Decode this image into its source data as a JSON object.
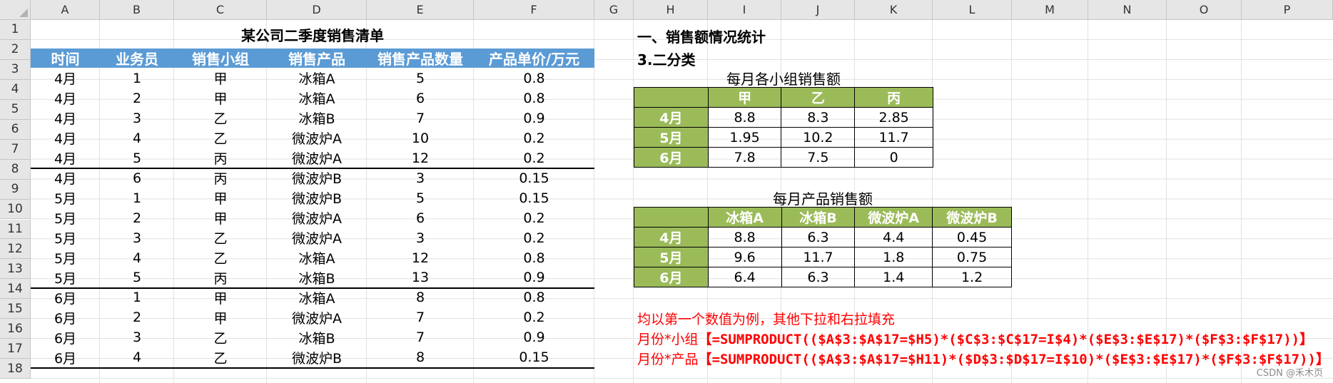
{
  "columns": [
    "A",
    "B",
    "C",
    "D",
    "E",
    "F",
    "G",
    "H",
    "I",
    "J",
    "K",
    "L",
    "M",
    "N",
    "O",
    "P"
  ],
  "rows": [
    "1",
    "2",
    "3",
    "4",
    "5",
    "6",
    "7",
    "8",
    "9",
    "10",
    "11",
    "12",
    "13",
    "14",
    "15",
    "16",
    "17",
    "18"
  ],
  "sheet_title": "某公司二季度销售清单",
  "table_headers": [
    "时间",
    "业务员",
    "销售小组",
    "销售产品",
    "销售产品数量",
    "产品单价/万元"
  ],
  "table_rows": [
    [
      "4月",
      "1",
      "甲",
      "冰箱A",
      "5",
      "0.8"
    ],
    [
      "4月",
      "2",
      "甲",
      "冰箱A",
      "6",
      "0.8"
    ],
    [
      "4月",
      "3",
      "乙",
      "冰箱B",
      "7",
      "0.9"
    ],
    [
      "4月",
      "4",
      "乙",
      "微波炉A",
      "10",
      "0.2"
    ],
    [
      "4月",
      "5",
      "丙",
      "微波炉A",
      "12",
      "0.2"
    ],
    [
      "4月",
      "6",
      "丙",
      "微波炉B",
      "3",
      "0.15"
    ],
    [
      "5月",
      "1",
      "甲",
      "微波炉B",
      "5",
      "0.15"
    ],
    [
      "5月",
      "2",
      "甲",
      "微波炉A",
      "6",
      "0.2"
    ],
    [
      "5月",
      "3",
      "乙",
      "微波炉A",
      "3",
      "0.2"
    ],
    [
      "5月",
      "4",
      "乙",
      "冰箱A",
      "12",
      "0.8"
    ],
    [
      "5月",
      "5",
      "丙",
      "冰箱B",
      "13",
      "0.9"
    ],
    [
      "6月",
      "1",
      "甲",
      "冰箱A",
      "8",
      "0.8"
    ],
    [
      "6月",
      "2",
      "甲",
      "微波炉A",
      "7",
      "0.2"
    ],
    [
      "6月",
      "3",
      "乙",
      "冰箱B",
      "7",
      "0.9"
    ],
    [
      "6月",
      "4",
      "乙",
      "微波炉B",
      "8",
      "0.15"
    ]
  ],
  "section_title": "一、销售额情况统计",
  "subsection": "3.二分类",
  "pivot1": {
    "title": "每月各小组销售额",
    "col_headers": [
      "甲",
      "乙",
      "丙"
    ],
    "row_headers": [
      "4月",
      "5月",
      "6月"
    ],
    "values": [
      [
        "8.8",
        "8.3",
        "2.85"
      ],
      [
        "1.95",
        "10.2",
        "11.7"
      ],
      [
        "7.8",
        "7.5",
        "0"
      ]
    ]
  },
  "pivot2": {
    "title": "每月产品销售额",
    "col_headers": [
      "冰箱A",
      "冰箱B",
      "微波炉A",
      "微波炉B"
    ],
    "row_headers": [
      "4月",
      "5月",
      "6月"
    ],
    "values": [
      [
        "8.8",
        "6.3",
        "4.4",
        "0.45"
      ],
      [
        "9.6",
        "11.7",
        "1.8",
        "0.75"
      ],
      [
        "6.4",
        "6.3",
        "1.4",
        "1.2"
      ]
    ]
  },
  "notes": {
    "line1": "均以第一个数值为例，其他下拉和右拉填充",
    "line2_label": "月份*小组",
    "line2_formula": "【=SUMPRODUCT(($A$3:$A$17=$H5)*($C$3:$C$17=I$4)*($E$3:$E$17)*($F$3:$F$17))】",
    "line3_label": "月份*产品",
    "line3_formula": "【=SUMPRODUCT(($A$3:$A$17=$H11)*($D$3:$D$17=I$10)*($E$3:$E$17)*($F$3:$F$17))】"
  },
  "watermark": "CSDN @禾木页",
  "colors": {
    "table_header": "#5b9bd5",
    "pivot_header": "#9bbb59",
    "note_text": "#ff0000"
  }
}
